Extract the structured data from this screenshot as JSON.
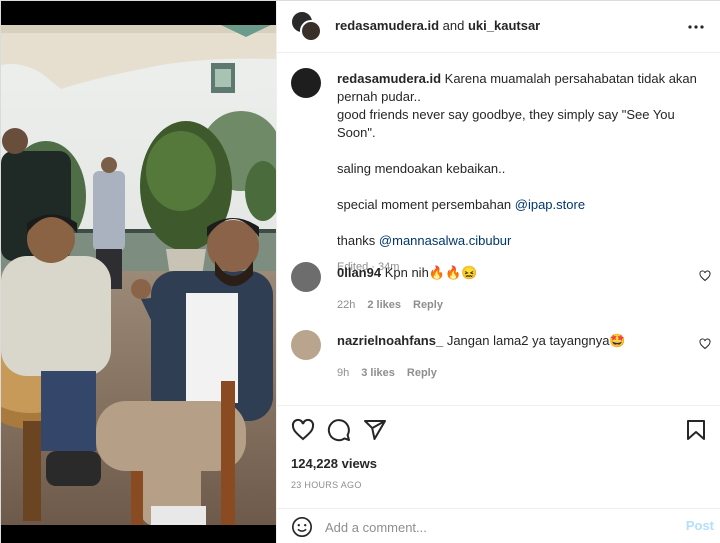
{
  "header": {
    "user1": "redasamudera.id",
    "joiner": " and ",
    "user2": "uki_kautsar",
    "more_icon": "more-horizontal-icon"
  },
  "caption": {
    "username": "redasamudera.id",
    "line1": " Karena muamalah persahabatan tidak akan pernah pudar..",
    "line2": "good friends never say goodbye, they simply say \"See You Soon\".",
    "line3": "saling mendoakan kebaikan..",
    "line4_text": "special moment persembahan ",
    "line4_link": "@ipap.store",
    "line5_text": "thanks ",
    "line5_link": "@mannasalwa.cibubur",
    "meta": "Edited · 34m"
  },
  "comments": [
    {
      "username": "0llan94",
      "text": " Kpn nih🔥🔥😖",
      "time": "22h",
      "likes": "2 likes",
      "reply": "Reply"
    },
    {
      "username": "nazrielnoahfans_",
      "text": " Jangan lama2 ya tayangnya🤩",
      "time": "9h",
      "likes": "3 likes",
      "reply": "Reply"
    }
  ],
  "stats": {
    "views": "124,228 views",
    "posted": "23 HOURS AGO"
  },
  "add_comment": {
    "placeholder": "Add a comment...",
    "post_label": "Post"
  },
  "colors": {
    "link": "#00376b",
    "muted": "#8e8e8e",
    "post_disabled": "#b2dffc"
  }
}
